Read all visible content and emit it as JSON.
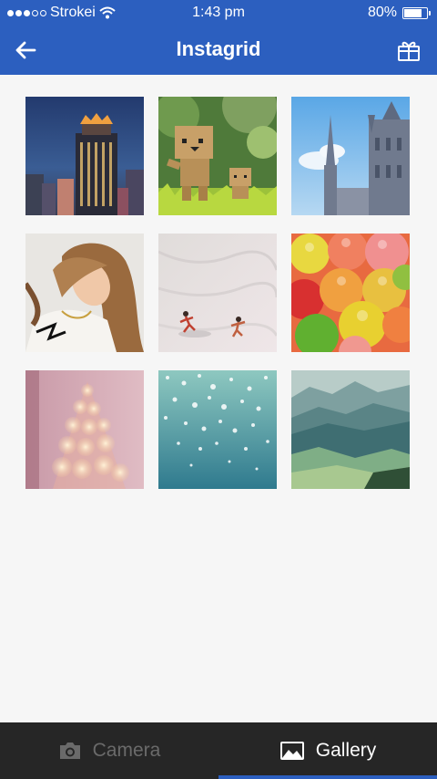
{
  "status_bar": {
    "carrier": "Strokei",
    "time": "1:43 pm",
    "battery": "80%",
    "battery_level": 0.8,
    "signal_bars_full": 3,
    "signal_bars_total": 5
  },
  "header": {
    "title": "Instagrid",
    "back_icon": "arrow-left-icon",
    "right_icon": "gift-icon"
  },
  "gallery": {
    "photos": [
      {
        "subject": "city-tower-night"
      },
      {
        "subject": "cardboard-robots-grass"
      },
      {
        "subject": "cathedral-spires-sky"
      },
      {
        "subject": "girl-portrait"
      },
      {
        "subject": "people-on-sand"
      },
      {
        "subject": "gummy-candies"
      },
      {
        "subject": "bokeh-christmas-tree"
      },
      {
        "subject": "sparkling-water"
      },
      {
        "subject": "misty-mountains"
      }
    ]
  },
  "tab_bar": {
    "camera_label": "Camera",
    "gallery_label": "Gallery",
    "active_tab": "Gallery"
  },
  "colors": {
    "brand_blue": "#2c5fbf",
    "tab_bar_bg": "#262626",
    "content_bg": "#f6f6f6"
  }
}
